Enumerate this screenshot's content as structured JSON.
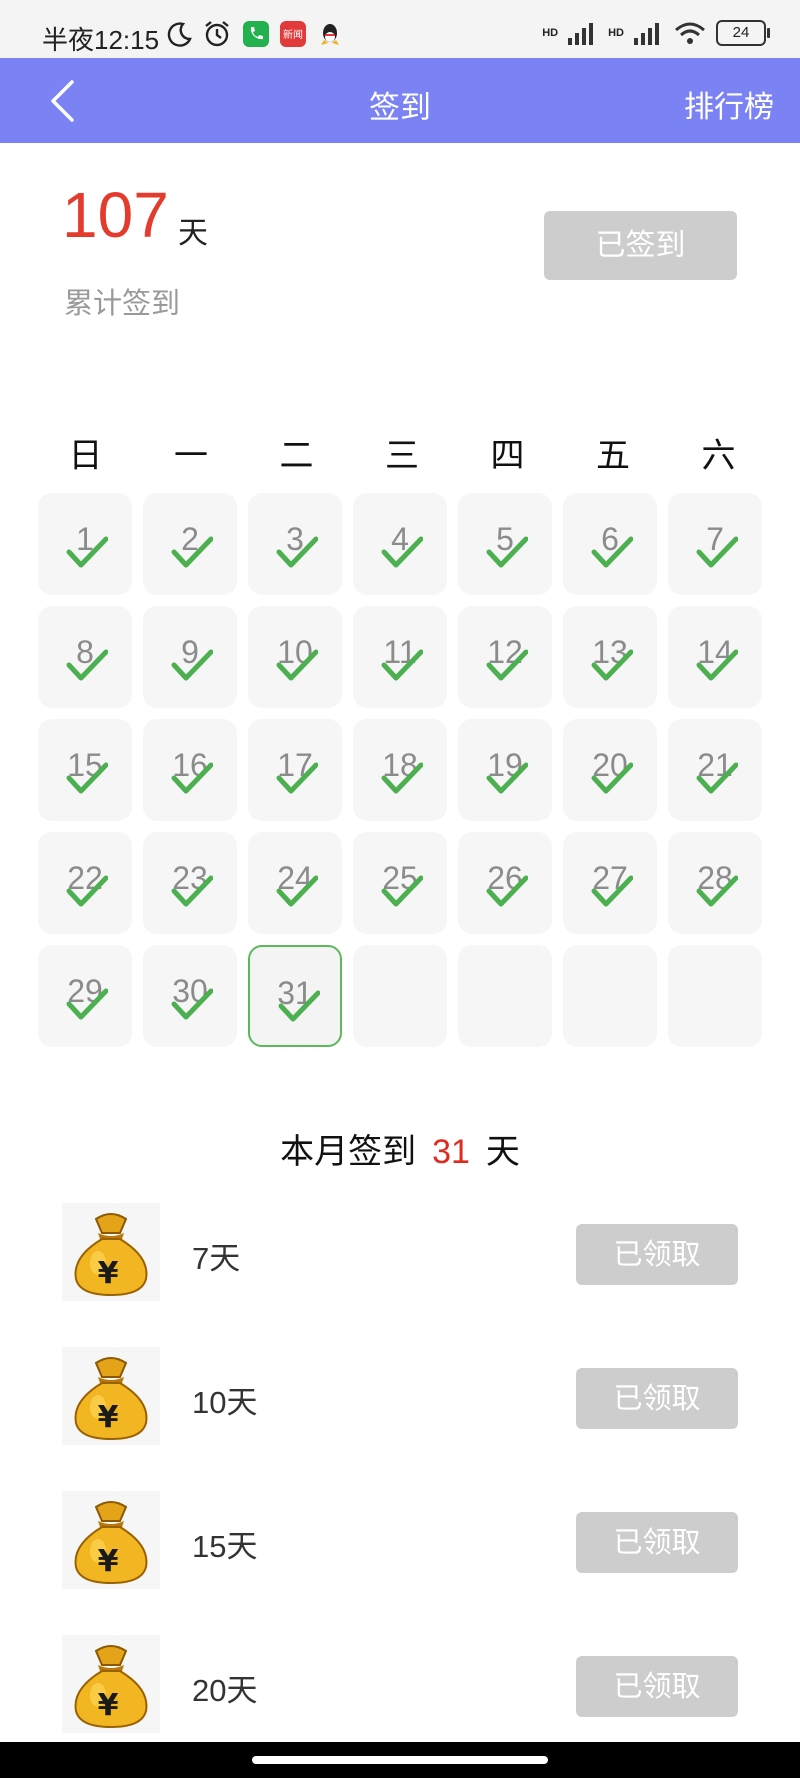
{
  "status_bar": {
    "time": "半夜12:15",
    "news_app_label": "新闻",
    "network_1": "HD",
    "network_2": "HD",
    "battery": "24"
  },
  "header": {
    "title": "签到",
    "right_action": "排行榜",
    "back_icon": "chevron-left-icon",
    "color": "#7b83f4"
  },
  "summary": {
    "total_days": "107",
    "unit": "天",
    "label": "累计签到",
    "signed_button": "已签到"
  },
  "calendar": {
    "weekdays": [
      "日",
      "一",
      "二",
      "三",
      "四",
      "五",
      "六"
    ],
    "days": [
      "1",
      "2",
      "3",
      "4",
      "5",
      "6",
      "7",
      "8",
      "9",
      "10",
      "11",
      "12",
      "13",
      "14",
      "15",
      "16",
      "17",
      "18",
      "19",
      "20",
      "21",
      "22",
      "23",
      "24",
      "25",
      "26",
      "27",
      "28",
      "29",
      "30",
      "31"
    ],
    "signed_through": 31,
    "today": "31",
    "blank_trailing": 4,
    "check_color": "#4caf50"
  },
  "monthly": {
    "prefix": "本月签到",
    "count": "31",
    "suffix": "天"
  },
  "rewards": [
    {
      "label": "7天",
      "button": "已领取",
      "icon": "money-bag-icon"
    },
    {
      "label": "10天",
      "button": "已领取",
      "icon": "money-bag-icon"
    },
    {
      "label": "15天",
      "button": "已领取",
      "icon": "money-bag-icon"
    },
    {
      "label": "20天",
      "button": "已领取",
      "icon": "money-bag-icon"
    }
  ]
}
